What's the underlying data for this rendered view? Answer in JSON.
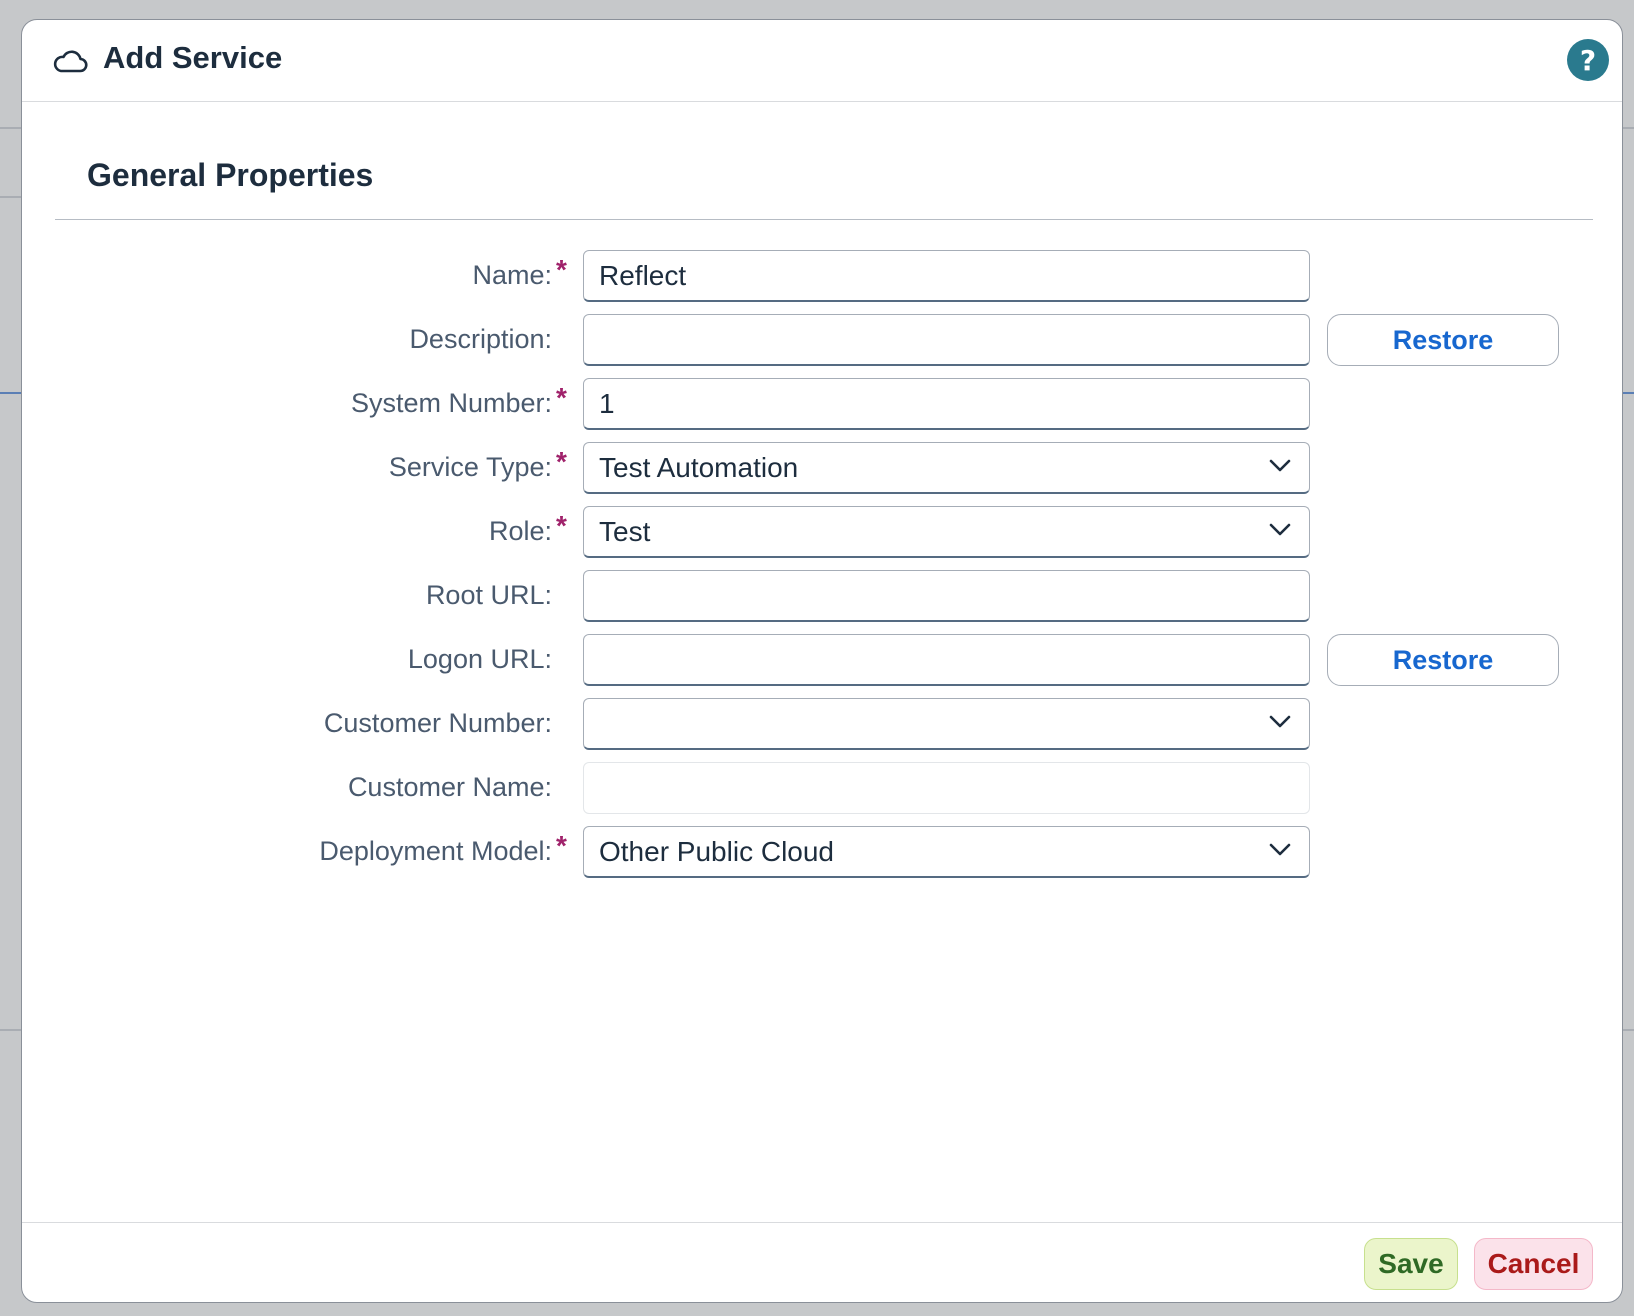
{
  "dialog": {
    "title": "Add Service",
    "header_icon": "cloud-icon",
    "help_icon": "help-icon",
    "help_glyph": "?"
  },
  "section": {
    "title": "General Properties"
  },
  "fields": {
    "name": {
      "label": "Name:",
      "required": true,
      "value": "Reflect"
    },
    "description": {
      "label": "Description:",
      "required": false,
      "value": "",
      "restore_label": "Restore"
    },
    "system_number": {
      "label": "System Number:",
      "required": true,
      "value": "1"
    },
    "service_type": {
      "label": "Service Type:",
      "required": true,
      "value": "Test Automation"
    },
    "role": {
      "label": "Role:",
      "required": true,
      "value": "Test"
    },
    "root_url": {
      "label": "Root URL:",
      "required": false,
      "value": ""
    },
    "logon_url": {
      "label": "Logon URL:",
      "required": false,
      "value": "",
      "restore_label": "Restore"
    },
    "customer_number": {
      "label": "Customer Number:",
      "required": false,
      "value": ""
    },
    "customer_name": {
      "label": "Customer Name:",
      "required": false,
      "value": "",
      "disabled": true
    },
    "deployment_model": {
      "label": "Deployment Model:",
      "required": true,
      "value": "Other Public Cloud"
    }
  },
  "required_marker": "*",
  "footer": {
    "save_label": "Save",
    "cancel_label": "Cancel"
  },
  "colors": {
    "accent_help": "#2a7a8e",
    "required_star": "#a0226b",
    "link_blue": "#1767cf",
    "save_bg": "#ebf5cb",
    "save_text": "#2f6a25",
    "cancel_bg": "#fbe2ea",
    "cancel_text": "#aa1a1a"
  }
}
